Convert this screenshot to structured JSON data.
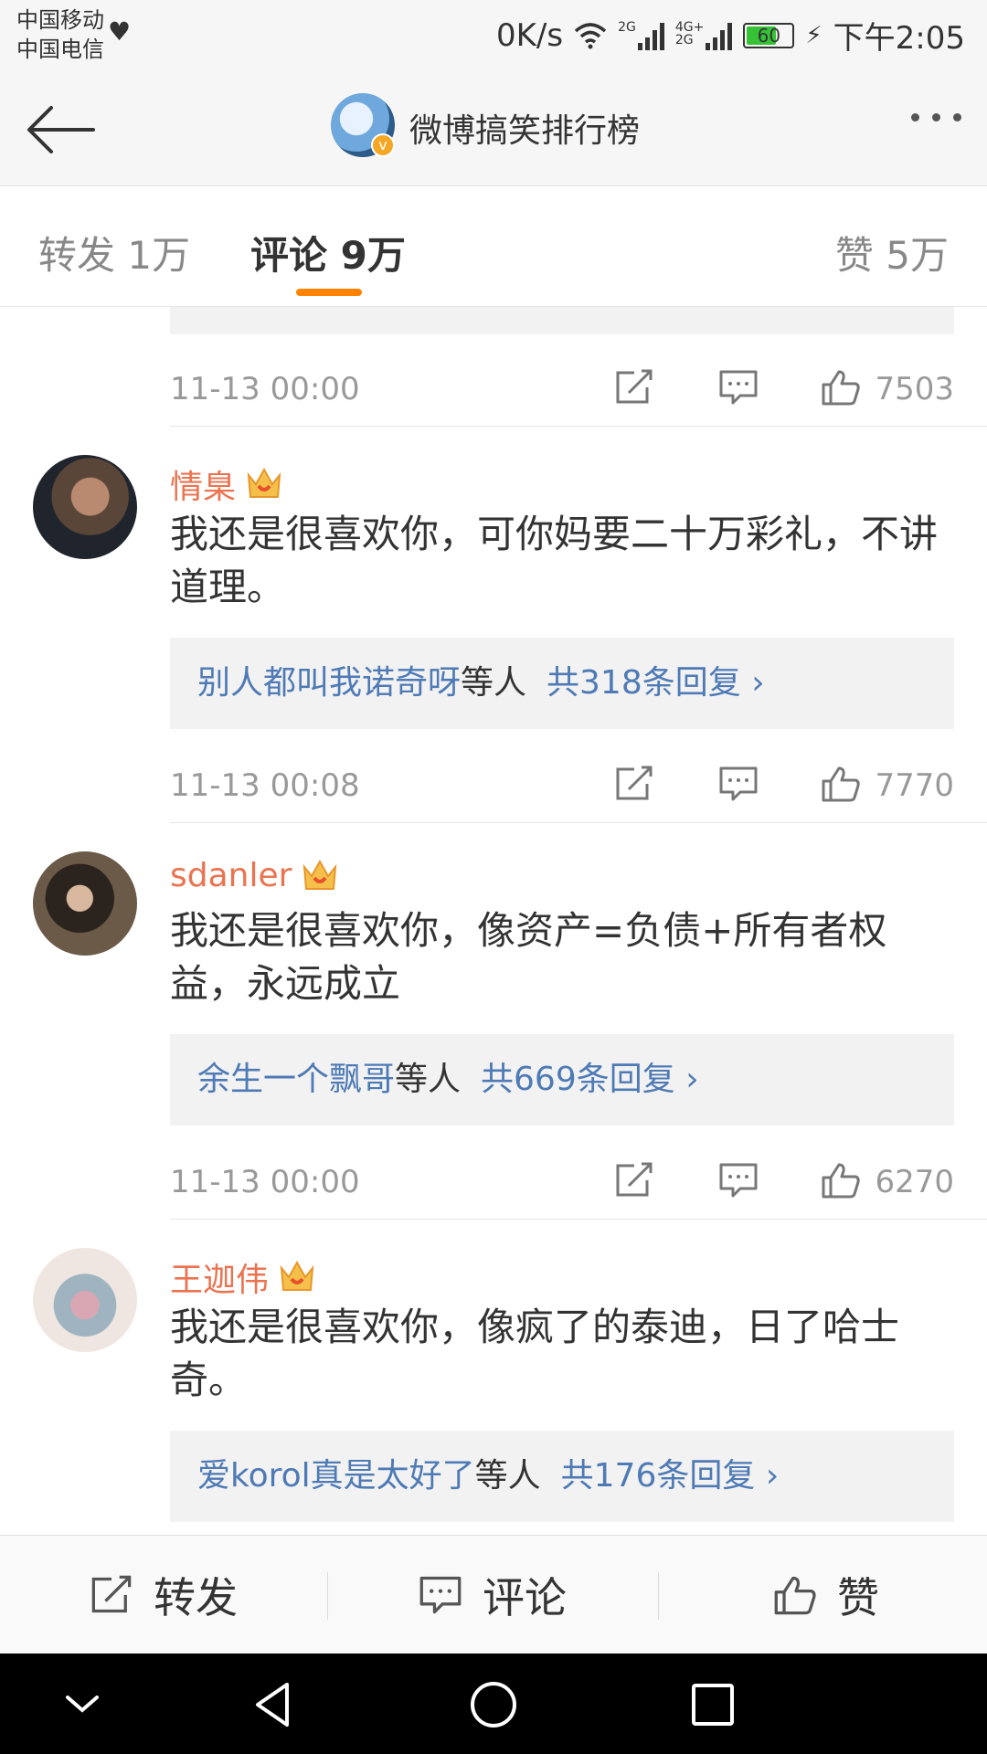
{
  "status": {
    "carrier1": "中国移动",
    "carrier2": "中国电信",
    "speed": "0K/s",
    "net1": "2G",
    "net2": "4G+",
    "net3": "2G",
    "battery": "60",
    "time": "下午2:05"
  },
  "header": {
    "title": "微博搞笑排行榜"
  },
  "tabs": [
    {
      "label": "转发 1万"
    },
    {
      "label": "评论 9万"
    },
    {
      "label": "赞 5万"
    }
  ],
  "first": {
    "time": "11-13 00:00",
    "likes": "7503"
  },
  "comments": [
    {
      "name": "情臬",
      "text": "我还是很喜欢你，可你妈要二十万彩礼，不讲道理。",
      "reply_users": "别人都叫我诺奇呀",
      "reply_suffix": "等人",
      "reply_count": "共318条回复 ›",
      "time": "11-13 00:08",
      "likes": "7770"
    },
    {
      "name": "sdanler",
      "text": "我还是很喜欢你，像资产=负债+所有者权益，永远成立",
      "reply_users": "余生一个飘哥",
      "reply_suffix": "等人",
      "reply_count": "共669条回复 ›",
      "time": "11-13 00:00",
      "likes": "6270"
    },
    {
      "name": "王迦伟",
      "text": "我还是很喜欢你，像疯了的泰迪，日了哈士奇。",
      "reply_users": "爱korol真是太好了",
      "reply_suffix": "等人",
      "reply_count": "共176条回复 ›",
      "time": "",
      "likes": ""
    }
  ],
  "bottom": {
    "repost": "转发",
    "comment": "评论",
    "like": "赞"
  },
  "colors": {
    "accent": "#ff8200",
    "username": "#eb7350",
    "link": "#4e7ab5"
  }
}
